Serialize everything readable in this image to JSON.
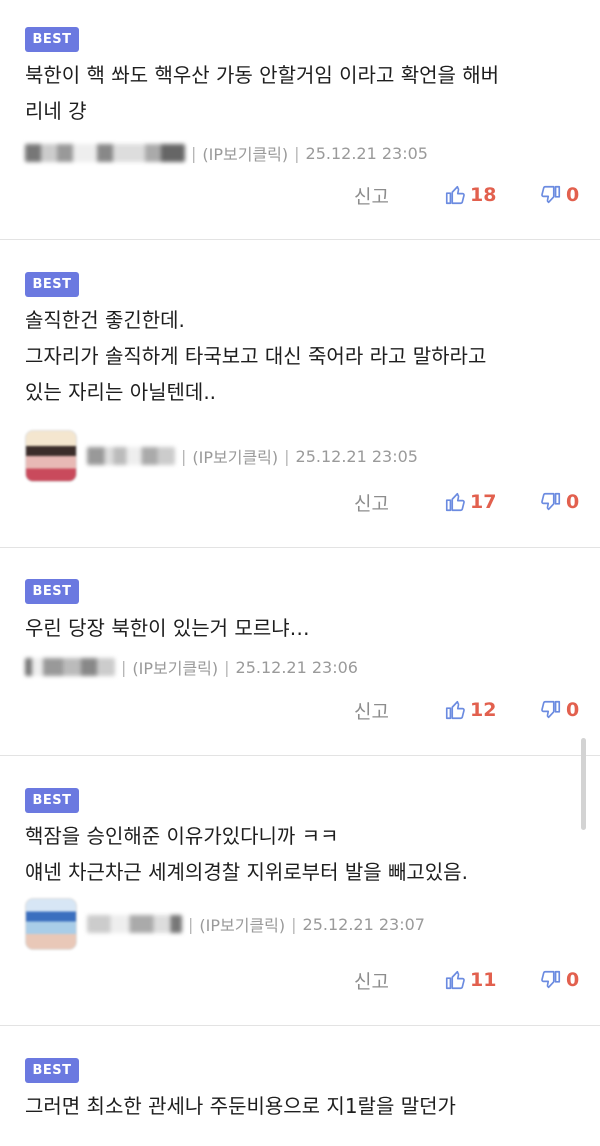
{
  "badge_label": "BEST",
  "report_label": "신고",
  "comments": [
    {
      "lines": [
        "북한이 핵 쏴도 핵우산 가동 안할거임 이라고 확언을 해버",
        "리네 걍"
      ],
      "ip_label": "(IP보기클릭)",
      "timestamp": "25.12.21 23:05",
      "likes": "18",
      "dislikes": "0"
    },
    {
      "lines": [
        "솔직한건 좋긴한데.",
        "그자리가 솔직하게 타국보고 대신 죽어라 라고 말하라고",
        "있는 자리는 아닐텐데.."
      ],
      "ip_label": "(IP보기클릭)",
      "timestamp": "25.12.21 23:05",
      "likes": "17",
      "dislikes": "0"
    },
    {
      "lines": [
        "우린 당장 북한이 있는거 모르냐…"
      ],
      "ip_label": "(IP보기클릭)",
      "timestamp": "25.12.21 23:06",
      "likes": "12",
      "dislikes": "0"
    },
    {
      "lines": [
        "핵잠을 승인해준 이유가있다니까 ㅋㅋ",
        "얘넨 차근차근 세계의경찰 지위로부터 발을 빼고있음."
      ],
      "ip_label": "(IP보기클릭)",
      "timestamp": "25.12.21 23:07",
      "likes": "11",
      "dislikes": "0"
    },
    {
      "lines": [
        "그러면 최소한 관세나 주둔비용으로 지1랄을 말던가"
      ]
    }
  ],
  "colors": {
    "badge": "#6b79e0",
    "count": "#e2604e",
    "thumb_icon": "#6b8be0"
  }
}
